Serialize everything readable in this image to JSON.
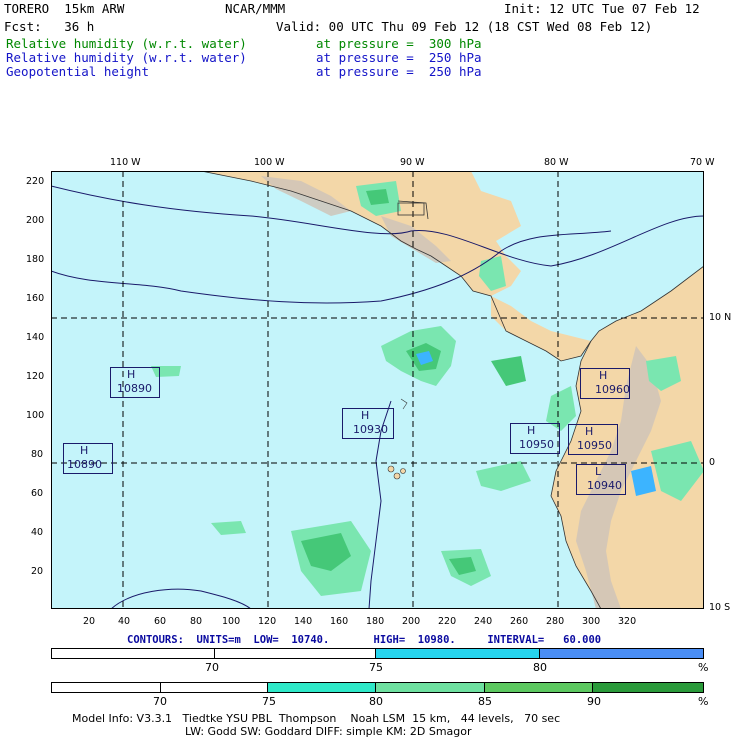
{
  "header": {
    "model_name": "TORERO  15km ARW",
    "center": "NCAR/MMM",
    "init": "Init: 12 UTC Tue 07 Feb 12",
    "fcst": "Fcst:   36 h",
    "valid": "Valid: 00 UTC Thu 09 Feb 12 (18 CST Wed 08 Feb 12)",
    "fields": [
      {
        "name": "Relative humidity (w.r.t. water)",
        "level": "at pressure =  300 hPa",
        "color": "#008800"
      },
      {
        "name": "Relative humidity (w.r.t. water)",
        "level": "at pressure =  250 hPa",
        "color": "#1414c8"
      },
      {
        "name": "Geopotential height",
        "level": "at pressure =  250 hPa",
        "color": "#1414c8"
      }
    ]
  },
  "map": {
    "lon_labels": [
      "110 W",
      "100 W",
      "90 W",
      "80 W",
      "70 W"
    ],
    "lat_labels": [
      "10 N",
      "0",
      "10 S"
    ],
    "y_ticks": [
      "220",
      "200",
      "180",
      "160",
      "140",
      "120",
      "100",
      "80",
      "60",
      "40",
      "20"
    ],
    "x_ticks": [
      "20",
      "40",
      "60",
      "80",
      "100",
      "120",
      "140",
      "160",
      "180",
      "200",
      "220",
      "240",
      "260",
      "280",
      "300",
      "320"
    ],
    "highs_lows": [
      {
        "type": "H",
        "value": "10890"
      },
      {
        "type": "H",
        "value": "10890"
      },
      {
        "type": "H",
        "value": "10930"
      },
      {
        "type": "H",
        "value": "10950"
      },
      {
        "type": "H",
        "value": "10960"
      },
      {
        "type": "H",
        "value": "10950"
      },
      {
        "type": "L",
        "value": "10940"
      }
    ],
    "colors": {
      "ocean": "#c4f4fa",
      "land": "#f3d7a8",
      "mountain": "#cfc4b8",
      "rh_light": "#7ae6b0",
      "rh_mid": "#45c878",
      "rh_blue": "#3cb4ff"
    }
  },
  "contours": "CONTOURS:  UNITS=m  LOW=  10740.       HIGH=  10980.     INTERVAL=   60.000",
  "colorbar1": {
    "labels": [
      "70",
      "75",
      "80",
      "%"
    ],
    "colors": [
      "#ffffff",
      "#ffffff",
      "#27d4ee",
      "#4a8ef5"
    ]
  },
  "colorbar2": {
    "labels": [
      "70",
      "75",
      "80",
      "85",
      "90",
      "%"
    ],
    "colors": [
      "#ffffff",
      "#ffffff",
      "#ffffff",
      "#2ee8c8",
      "#6ee0a0",
      "#5cc860",
      "#2a9a3a"
    ]
  },
  "footer": {
    "line1": "Model Info: V3.3.1   Tiedtke YSU PBL  Thompson    Noah LSM  15 km,   44 levels,   70 sec",
    "line2": "LW: Godd SW: Goddard DIFF: simple KM: 2D Smagor"
  }
}
